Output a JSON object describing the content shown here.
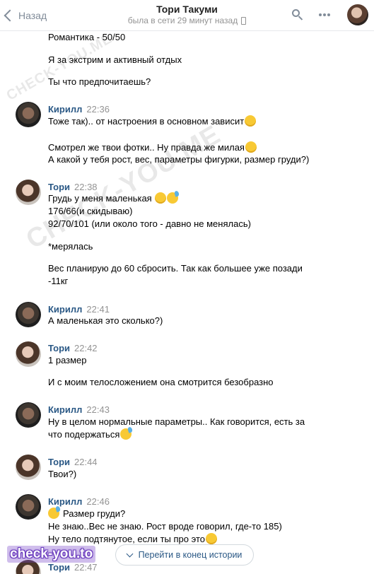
{
  "header": {
    "back_label": "Назад",
    "title": "Тори Такуми",
    "status": "была в сети 29 минут назад"
  },
  "watermarks": {
    "main": "CHECK-YOU.ME",
    "site": "check-you.to"
  },
  "messages": {
    "m0": {
      "lines": [
        "Романтика - 50/50",
        "Я за экстрим и активный отдых",
        "Ты что предпочитаешь?"
      ]
    },
    "m1": {
      "author": "Кирилл",
      "time": "22:36",
      "lines": [
        "Тоже так).. от настроения в основном зависит",
        "Смотрел же твои фотки.. Ну правда же милая",
        "А какой у тебя рост, вес, параметры фигурки, размер груди?)"
      ]
    },
    "m2": {
      "author": "Тори",
      "time": "22:38",
      "lines": [
        "Грудь у меня маленькая",
        "176/66(и скидываю)",
        "92/70/101 (или около того - давно не менялась)",
        "*мерялась",
        "Вес планирую до 60 сбросить. Так как большее уже позади",
        "-11кг"
      ]
    },
    "m3": {
      "author": "Кирилл",
      "time": "22:41",
      "lines": [
        "А маленькая это сколько?)"
      ]
    },
    "m4": {
      "author": "Тори",
      "time": "22:42",
      "lines": [
        "1 размер",
        "И с моим телосложением она смотрится безобразно"
      ]
    },
    "m5": {
      "author": "Кирилл",
      "time": "22:43",
      "lines": [
        "Ну в целом нормальные параметры.. Как говорится, есть за",
        "что подержаться"
      ]
    },
    "m6": {
      "author": "Тори",
      "time": "22:44",
      "lines": [
        "Твои?)"
      ]
    },
    "m7": {
      "author": "Кирилл",
      "time": "22:46",
      "lines": [
        "Размер груди?",
        "Не знаю..Вес не знаю. Рост вроде говорил, где-то 185)",
        "Ну тело подтянутое, если ты про это"
      ]
    },
    "m8": {
      "author": "Тори",
      "time": "22:47"
    }
  },
  "jump_button_label": "Перейти в конец истории",
  "icons": [
    "chevron-left-icon",
    "phone-icon",
    "search-icon",
    "more-icon",
    "emoji-icon",
    "arrow-down-icon"
  ]
}
